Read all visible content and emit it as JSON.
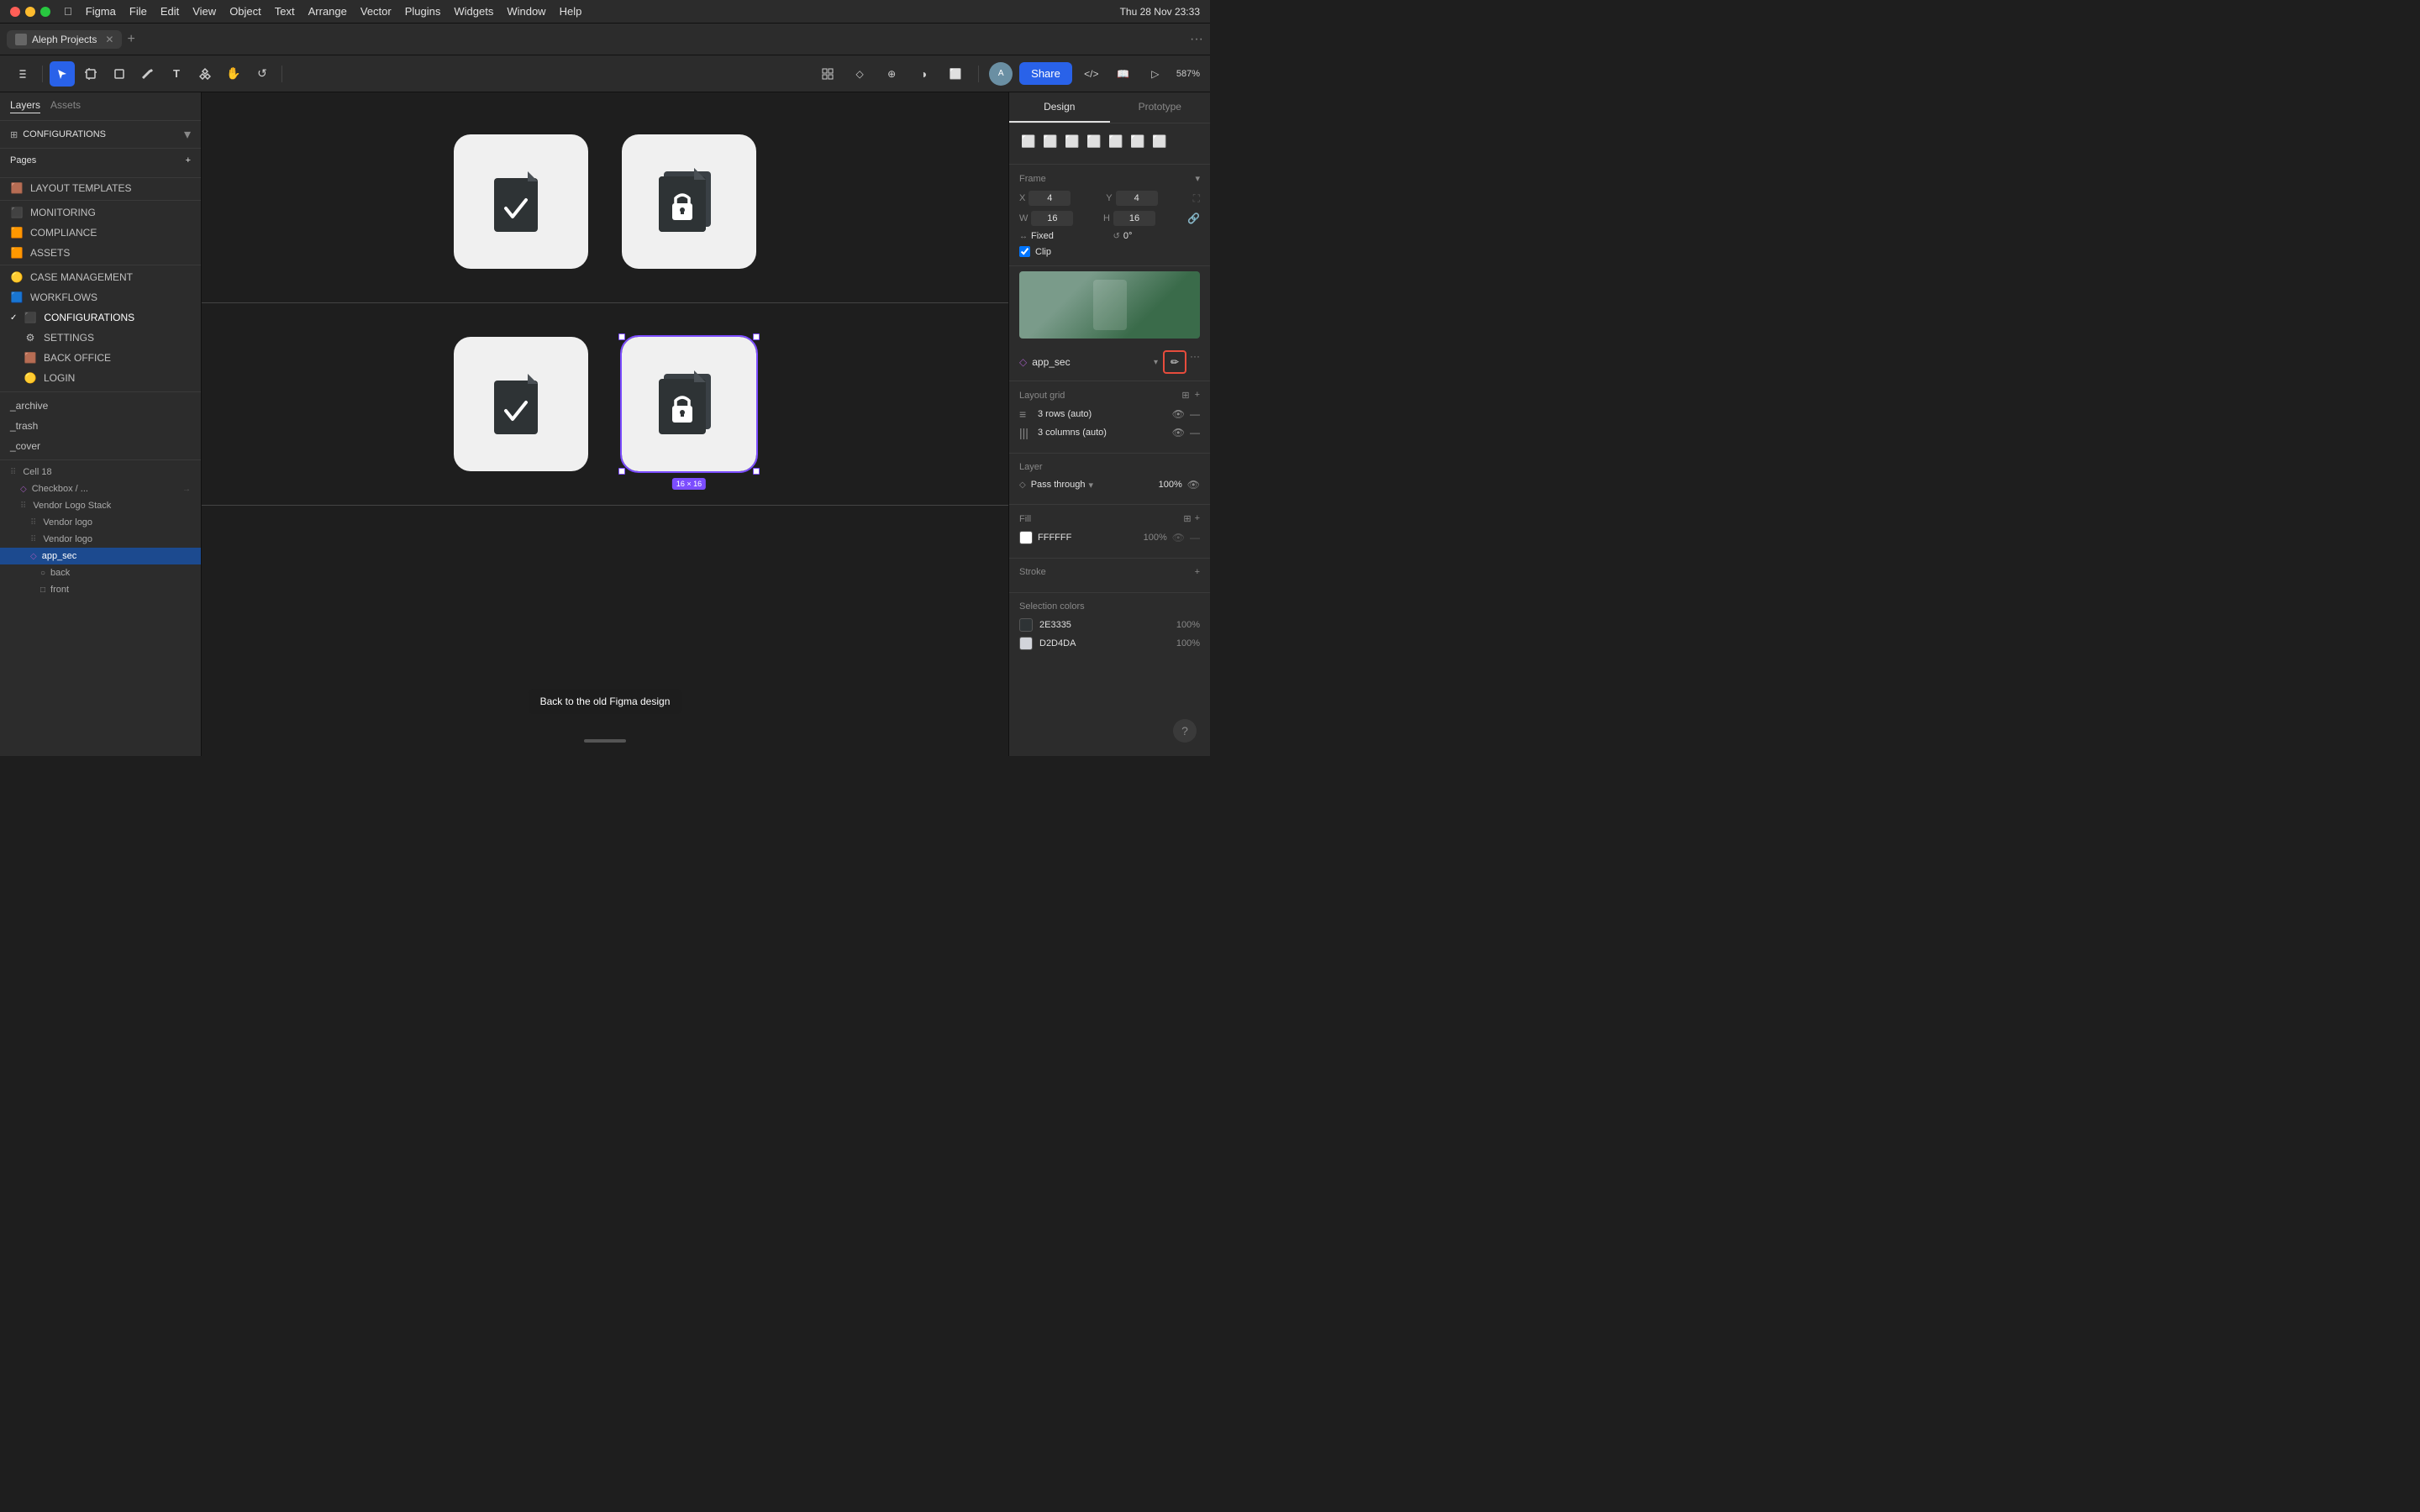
{
  "titlebar": {
    "menus": [
      "",
      "Figma",
      "File",
      "Edit",
      "View",
      "Object",
      "Text",
      "Arrange",
      "Vector",
      "Plugins",
      "Widgets",
      "Window",
      "Help"
    ],
    "time": "Thu 28 Nov  23:33"
  },
  "browser": {
    "tab_label": "Aleph Projects",
    "tab_favicon": "figma"
  },
  "toolbar": {
    "tools": [
      "☰",
      "↖",
      "⬜",
      "✏",
      "T",
      "✦",
      "✋",
      "↺"
    ],
    "right_tools": [
      "⊞",
      "◇",
      "⊕",
      "◑",
      "⬜"
    ],
    "share_label": "Share",
    "zoom": "587%"
  },
  "left_panel": {
    "tabs": [
      "Layers",
      "Assets"
    ],
    "active_tab": "Layers",
    "configurations_label": "CONFIGURATIONS",
    "pages_title": "Pages",
    "nav_items": [
      {
        "emoji": "🟫",
        "label": "LAYOUT TEMPLATES"
      },
      {
        "emoji": "⬛",
        "label": "MONITORING"
      },
      {
        "emoji": "🟧",
        "label": "COMPLIANCE"
      },
      {
        "emoji": "🟧",
        "label": "ASSETS"
      },
      {
        "emoji": "🟡",
        "label": "CASE MANAGEMENT"
      },
      {
        "emoji": "🟦",
        "label": "WORKFLOWS"
      },
      {
        "emoji": "⬛",
        "label": "CONFIGURATIONS",
        "active": true,
        "expanded": true
      },
      {
        "emoji": "⚙",
        "label": "SETTINGS",
        "sub": true
      },
      {
        "emoji": "🟫",
        "label": "BACK OFFICE",
        "sub": true
      },
      {
        "emoji": "🟡",
        "label": "LOGIN",
        "sub": true
      }
    ],
    "archive_items": [
      "_archive",
      "_trash",
      "_cover"
    ],
    "layers": [
      {
        "label": "Cell 18",
        "icon": "drag",
        "indent": 0
      },
      {
        "label": "Checkbox / ...",
        "icon": "diamond",
        "indent": 1,
        "arrow": true
      },
      {
        "label": "Vendor Logo Stack",
        "icon": "drag",
        "indent": 1
      },
      {
        "label": "Vendor logo",
        "icon": "drag",
        "indent": 2
      },
      {
        "label": "Vendor logo",
        "icon": "drag",
        "indent": 2
      },
      {
        "label": "app_sec",
        "icon": "diamond",
        "indent": 2,
        "selected": true
      },
      {
        "label": "back",
        "icon": "circle",
        "indent": 3
      },
      {
        "label": "front",
        "icon": "rect",
        "indent": 3
      }
    ]
  },
  "canvas": {
    "row1": [
      {
        "type": "doc_check",
        "selected": false
      },
      {
        "type": "doc_lock",
        "selected": false
      }
    ],
    "row2": [
      {
        "type": "doc_check",
        "selected": false
      },
      {
        "type": "doc_lock",
        "selected": true,
        "dim": "16 × 16"
      }
    ],
    "tooltip": "Back to the old Figma design"
  },
  "right_panel": {
    "tabs": [
      "Design",
      "Prototype"
    ],
    "active_tab": "Design",
    "frame_section": {
      "title": "Frame",
      "x_label": "X",
      "x_val": "4",
      "y_label": "Y",
      "y_val": "4",
      "w_label": "W",
      "w_val": "16",
      "h_label": "H",
      "h_val": "16",
      "constraint_label": "Fixed",
      "rotation": "0°",
      "clip_label": "Clip"
    },
    "component": {
      "name": "app_sec",
      "chevron": "▾"
    },
    "layout_grid": {
      "title": "Layout grid",
      "rows_label": "3 rows (auto)",
      "cols_label": "3 columns (auto)"
    },
    "layer": {
      "title": "Layer",
      "mode": "Pass through",
      "opacity": "100%"
    },
    "fill": {
      "title": "Fill",
      "hex": "FFFFFF",
      "opacity": "100%"
    },
    "stroke": {
      "title": "Stroke"
    },
    "selection_colors": {
      "title": "Selection colors",
      "colors": [
        {
          "hex": "2E3335",
          "opacity": "100%",
          "dark": true
        },
        {
          "hex": "D2D4DA",
          "opacity": "100%",
          "dark": false
        }
      ]
    },
    "help": "?"
  }
}
